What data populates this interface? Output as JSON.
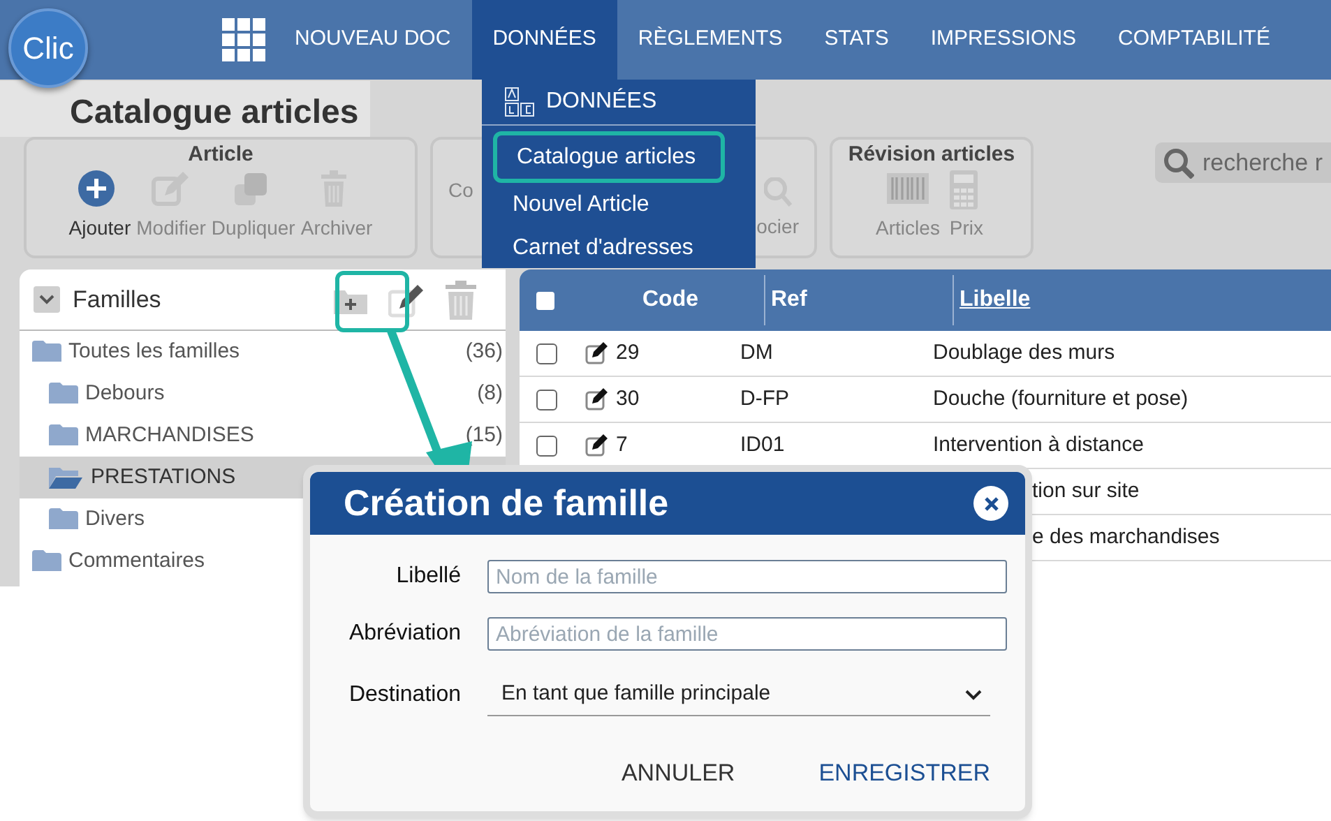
{
  "app_logo": {
    "text": "Clic"
  },
  "nav": [
    {
      "label": "NOUVEAU DOC",
      "selected": false
    },
    {
      "label": "DONNÉES",
      "selected": true
    },
    {
      "label": "RÈGLEMENTS",
      "selected": false
    },
    {
      "label": "STATS",
      "selected": false
    },
    {
      "label": "IMPRESSIONS",
      "selected": false
    },
    {
      "label": "COMPTABILITÉ",
      "selected": false
    }
  ],
  "dropdown_menu": {
    "title": "DONNÉES",
    "items": [
      {
        "label": "Catalogue articles",
        "highlighted": true
      },
      {
        "label": "Nouvel Article",
        "highlighted": false
      },
      {
        "label": "Carnet d'adresses",
        "highlighted": false
      }
    ]
  },
  "page_title": "Catalogue articles",
  "toolbar_groups": [
    {
      "title": "Article",
      "buttons": [
        {
          "label": "Ajouter",
          "disabled": false
        },
        {
          "label": "Modifier",
          "disabled": true
        },
        {
          "label": "Dupliquer",
          "disabled": true
        },
        {
          "label": "Archiver",
          "disabled": true
        }
      ]
    },
    {
      "buttons": [
        {
          "label": "Co",
          "disabled": true
        },
        {
          "label": "ocier",
          "disabled": true
        }
      ]
    },
    {
      "title": "Révision articles",
      "buttons": [
        {
          "label": "Articles",
          "disabled": true
        },
        {
          "label": "Prix",
          "disabled": true
        }
      ]
    }
  ],
  "search": {
    "placeholder": "recherche r"
  },
  "families_panel": {
    "title": "Familles",
    "add_highlighted": true,
    "tree": [
      {
        "label": "Toutes les familles",
        "count": "(36)",
        "selected": false,
        "children": [
          {
            "label": "Debours",
            "count": "(8)",
            "selected": false
          },
          {
            "label": "MARCHANDISES",
            "count": "(15)",
            "selected": false
          },
          {
            "label": "PRESTATIONS",
            "selected": true
          },
          {
            "label": "Divers",
            "selected": false
          }
        ]
      },
      {
        "label": "Commentaires",
        "selected": false
      }
    ]
  },
  "table": {
    "select_all_checked": false,
    "columns": [
      "Code",
      "Ref",
      "Libelle"
    ],
    "rows": [
      {
        "checked": false,
        "code": "29",
        "ref": "DM",
        "libelle": "Doublage des murs"
      },
      {
        "checked": false,
        "code": "30",
        "ref": "D-FP",
        "libelle": "Douche (fourniture et pose)"
      },
      {
        "checked": false,
        "code": "7",
        "ref": "ID01",
        "libelle": "Intervention à distance"
      },
      {
        "libelle": "tion sur site"
      },
      {
        "libelle": "e des marchandises"
      }
    ]
  },
  "dialog": {
    "title": "Création de famille",
    "fields": [
      {
        "kind": "text",
        "label": "Libellé",
        "placeholder": "Nom de la famille"
      },
      {
        "kind": "text",
        "label": "Abréviation",
        "placeholder": "Abréviation de la famille"
      },
      {
        "kind": "select",
        "label": "Destination",
        "value": "En tant que famille principale"
      }
    ],
    "buttons": [
      {
        "kind": "secondary",
        "label": "ANNULER"
      },
      {
        "kind": "primary",
        "label": "ENREGISTRER"
      }
    ]
  }
}
